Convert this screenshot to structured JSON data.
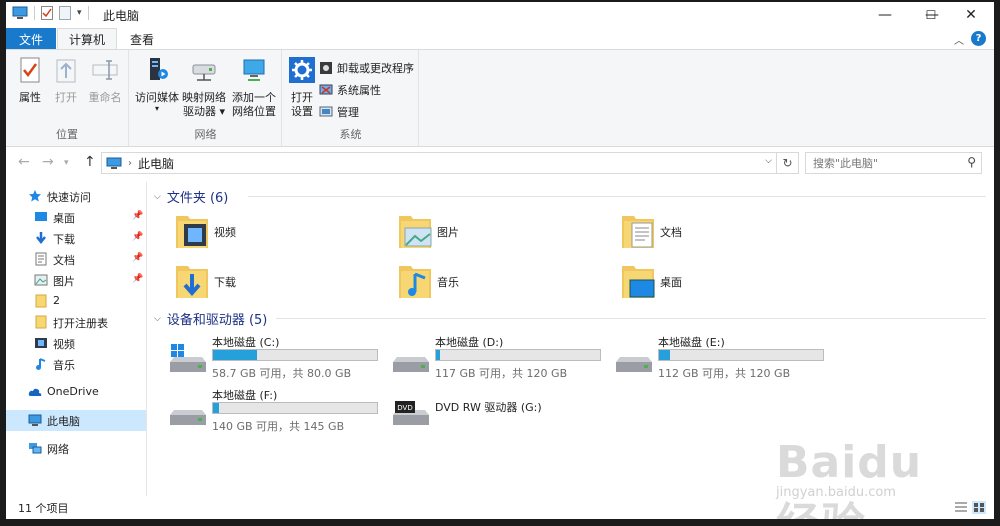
{
  "window": {
    "title": "此电脑",
    "controls": {
      "minimize": "—",
      "maximize": "☐",
      "close": "✕"
    }
  },
  "tabs": {
    "file": "文件",
    "computer": "计算机",
    "view": "查看",
    "help": "?"
  },
  "ribbon": {
    "location_group": {
      "label": "位置",
      "properties": "属性",
      "open": "打开",
      "rename": "重命名"
    },
    "network_group": {
      "label": "网络",
      "access_media": "访问媒体",
      "map_drive_line1": "映射网络",
      "map_drive_line2": "驱动器",
      "add_location_line1": "添加一个",
      "add_location_line2": "网络位置"
    },
    "system_group": {
      "label": "系统",
      "open_settings_line1": "打开",
      "open_settings_line2": "设置",
      "uninstall": "卸载或更改程序",
      "system_properties": "系统属性",
      "manage": "管理"
    }
  },
  "address": {
    "path": "此电脑",
    "search_placeholder": "搜索\"此电脑\""
  },
  "sidebar": {
    "quick_access": "快速访问",
    "items": [
      {
        "label": "桌面",
        "pinned": true
      },
      {
        "label": "下载",
        "pinned": true
      },
      {
        "label": "文档",
        "pinned": true
      },
      {
        "label": "图片",
        "pinned": true
      },
      {
        "label": "2"
      },
      {
        "label": "打开注册表"
      },
      {
        "label": "视频"
      },
      {
        "label": "音乐"
      }
    ],
    "onedrive": "OneDrive",
    "this_pc": "此电脑",
    "network": "网络"
  },
  "folders_section": {
    "title": "文件夹 (6)",
    "folders": [
      {
        "name": "视频",
        "icon": "video-folder-icon"
      },
      {
        "name": "图片",
        "icon": "pictures-folder-icon"
      },
      {
        "name": "文档",
        "icon": "documents-folder-icon"
      },
      {
        "name": "下载",
        "icon": "downloads-folder-icon"
      },
      {
        "name": "音乐",
        "icon": "music-folder-icon"
      },
      {
        "name": "桌面",
        "icon": "desktop-folder-icon"
      }
    ]
  },
  "drives_section": {
    "title": "设备和驱动器 (5)",
    "drives": [
      {
        "name": "本地磁盘 (C:)",
        "info": "58.7 GB 可用，共 80.0 GB",
        "used_fraction": 0.27
      },
      {
        "name": "本地磁盘 (D:)",
        "info": "117 GB 可用，共 120 GB",
        "used_fraction": 0.025
      },
      {
        "name": "本地磁盘 (E:)",
        "info": "112 GB 可用，共 120 GB",
        "used_fraction": 0.067
      },
      {
        "name": "本地磁盘 (F:)",
        "info": "140 GB 可用，共 145 GB",
        "used_fraction": 0.034
      },
      {
        "name": "DVD RW 驱动器 (G:)"
      }
    ]
  },
  "status": {
    "item_count": "11 个项目"
  },
  "watermark": {
    "brand": "Baidu经验",
    "url": "jingyan.baidu.com"
  }
}
